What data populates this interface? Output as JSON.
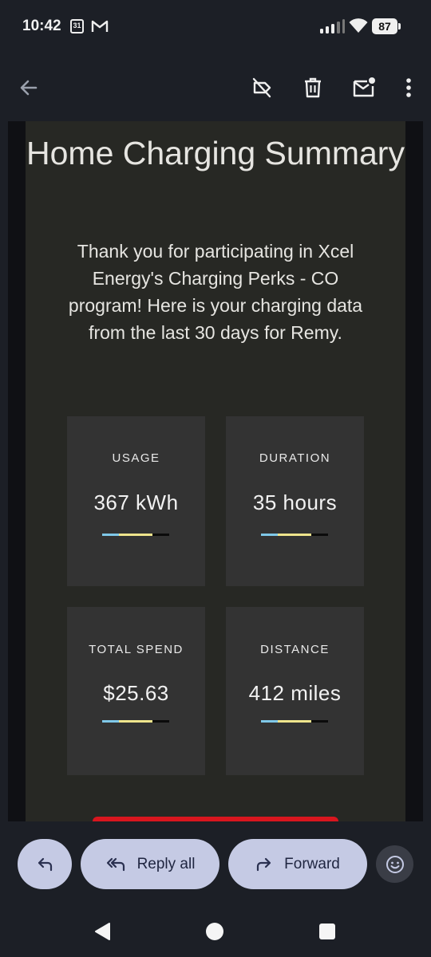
{
  "status_bar": {
    "time": "10:42",
    "calendar_day": "31",
    "battery": "87"
  },
  "toolbar": {
    "icons": [
      "back-arrow-icon",
      "label-off-icon",
      "delete-icon",
      "mark-unread-icon",
      "more-vert-icon"
    ]
  },
  "email": {
    "title": "Home Charging Summary",
    "intro": "Thank you for participating in Xcel Energy's Charging Perks - CO program! Here is your charging data from the last 30 days for Remy.",
    "stats": [
      {
        "label": "USAGE",
        "value": "367 kWh"
      },
      {
        "label": "DURATION",
        "value": "35 hours"
      },
      {
        "label": "TOTAL SPEND",
        "value": "$25.63"
      },
      {
        "label": "DISTANCE",
        "value": "412 miles"
      }
    ],
    "bar_colors": [
      "#7fc8e8",
      "#efe58c",
      "#efe58c",
      "#0b0b0b"
    ],
    "button_color": "#d8161e"
  },
  "actions": {
    "reply_all": "Reply all",
    "forward": "Forward"
  },
  "colors": {
    "pill": "#c5cae4",
    "background": "#1c1f26",
    "card": "#272824",
    "stat_tile": "#333333"
  }
}
